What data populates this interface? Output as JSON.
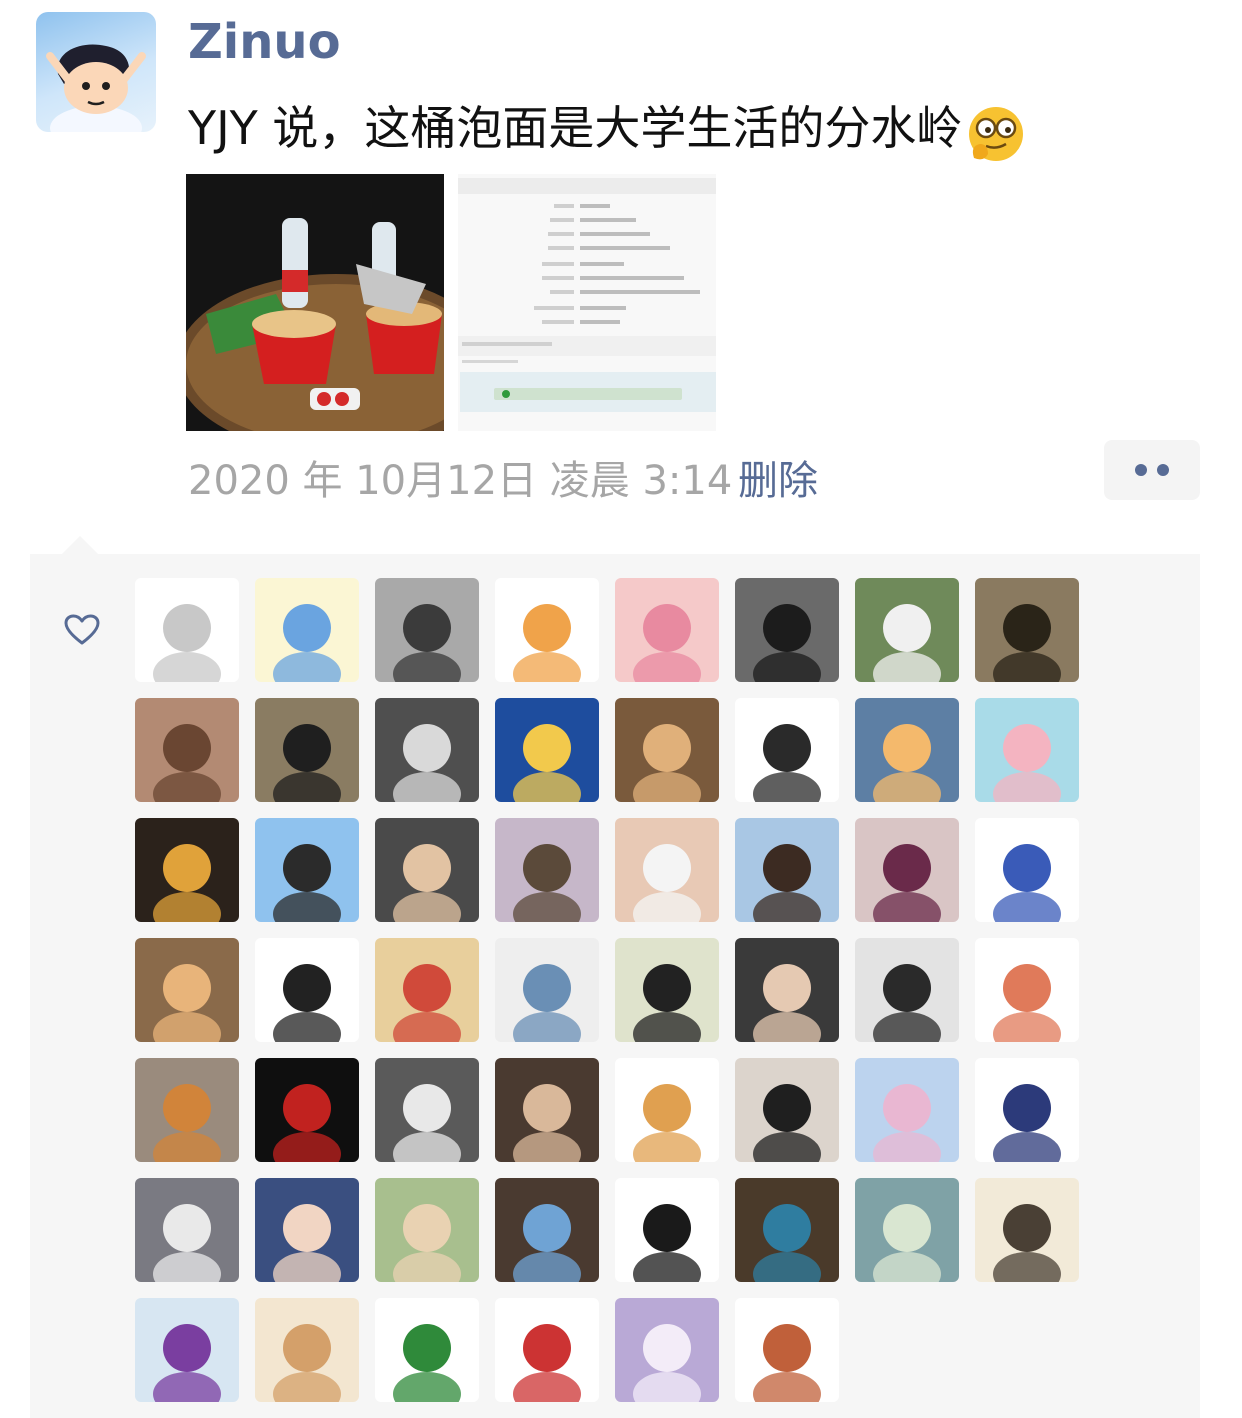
{
  "post": {
    "username": "Zinuo",
    "text": "YJY 说，这桶泡面是大学生活的分水岭",
    "emoji_icon": "smirk-glasses-emoji-icon",
    "date": "2020 年 10月12日",
    "time": "凌晨 3:14",
    "delete_label": "删除",
    "more_icon": "ellipsis-icon"
  },
  "likes": {
    "icon": "heart-outline-icon",
    "avatars": [
      {
        "bg": "#ffffff",
        "fg": "#c8c8c8"
      },
      {
        "bg": "#fbf6d4",
        "fg": "#6aa4e0"
      },
      {
        "bg": "#a9a9a9",
        "fg": "#3b3b3b"
      },
      {
        "bg": "#ffffff",
        "fg": "#f0a34a"
      },
      {
        "bg": "#f5c9c9",
        "fg": "#e88aa0"
      },
      {
        "bg": "#6a6a6a",
        "fg": "#1c1c1c"
      },
      {
        "bg": "#6f8a5a",
        "fg": "#f0f0f0"
      },
      {
        "bg": "#8a7a60",
        "fg": "#2a2418"
      },
      {
        "bg": "#b38a73",
        "fg": "#6a4632"
      },
      {
        "bg": "#8a7c62",
        "fg": "#1f1f1f"
      },
      {
        "bg": "#4f4f4f",
        "fg": "#d9d9d9"
      },
      {
        "bg": "#1e4d9e",
        "fg": "#f2c94c"
      },
      {
        "bg": "#7a5a3c",
        "fg": "#e0b07a"
      },
      {
        "bg": "#ffffff",
        "fg": "#2a2a2a"
      },
      {
        "bg": "#5d7fa4",
        "fg": "#f4b96c"
      },
      {
        "bg": "#a9dbe8",
        "fg": "#f4b4c1"
      },
      {
        "bg": "#2b221b",
        "fg": "#e0a23a"
      },
      {
        "bg": "#8fc2ee",
        "fg": "#2b2b2b"
      },
      {
        "bg": "#4a4a4a",
        "fg": "#e2c3a3"
      },
      {
        "bg": "#c6b7c9",
        "fg": "#5b4a3a"
      },
      {
        "bg": "#e8c9b5",
        "fg": "#f4f4f4"
      },
      {
        "bg": "#a9c7e4",
        "fg": "#3c2b22"
      },
      {
        "bg": "#d9c5c5",
        "fg": "#6a2a4a"
      },
      {
        "bg": "#ffffff",
        "fg": "#3a5bb8"
      },
      {
        "bg": "#8a6a4a",
        "fg": "#e8b47a"
      },
      {
        "bg": "#ffffff",
        "fg": "#222222"
      },
      {
        "bg": "#e8cf9c",
        "fg": "#d04a3a"
      },
      {
        "bg": "#eeeeee",
        "fg": "#6a8fb5"
      },
      {
        "bg": "#dfe3cc",
        "fg": "#222222"
      },
      {
        "bg": "#3a3a3a",
        "fg": "#e5c9b2"
      },
      {
        "bg": "#e3e3e3",
        "fg": "#2a2a2a"
      },
      {
        "bg": "#ffffff",
        "fg": "#e07a5a"
      },
      {
        "bg": "#9a8b7d",
        "fg": "#d1843a"
      },
      {
        "bg": "#0f0f0f",
        "fg": "#c1221f"
      },
      {
        "bg": "#5a5a5a",
        "fg": "#e8e8e8"
      },
      {
        "bg": "#4a3a30",
        "fg": "#d9b89a"
      },
      {
        "bg": "#ffffff",
        "fg": "#e0a050"
      },
      {
        "bg": "#dcd4cc",
        "fg": "#1f1f1f"
      },
      {
        "bg": "#bcd3ee",
        "fg": "#e9b7d2"
      },
      {
        "bg": "#ffffff",
        "fg": "#2c3a7a"
      },
      {
        "bg": "#7a7a82",
        "fg": "#e9e9e9"
      },
      {
        "bg": "#3a4f80",
        "fg": "#f1d5c3"
      },
      {
        "bg": "#a8bf8e",
        "fg": "#e9d2b2"
      },
      {
        "bg": "#4a3a30",
        "fg": "#6fa3d4"
      },
      {
        "bg": "#ffffff",
        "fg": "#1a1a1a"
      },
      {
        "bg": "#4a3a2a",
        "fg": "#2f7da0"
      },
      {
        "bg": "#7fa2a6",
        "fg": "#d9e6d1"
      },
      {
        "bg": "#f2ead8",
        "fg": "#4a4035"
      },
      {
        "bg": "#d7e6f2",
        "fg": "#7a3ea0"
      },
      {
        "bg": "#f3e6d0",
        "fg": "#d4a06a"
      },
      {
        "bg": "#ffffff",
        "fg": "#2f8a3a"
      },
      {
        "bg": "#ffffff",
        "fg": "#cc3333"
      },
      {
        "bg": "#b9a9d6",
        "fg": "#f3ecf8"
      },
      {
        "bg": "#ffffff",
        "fg": "#c0603a"
      }
    ]
  }
}
